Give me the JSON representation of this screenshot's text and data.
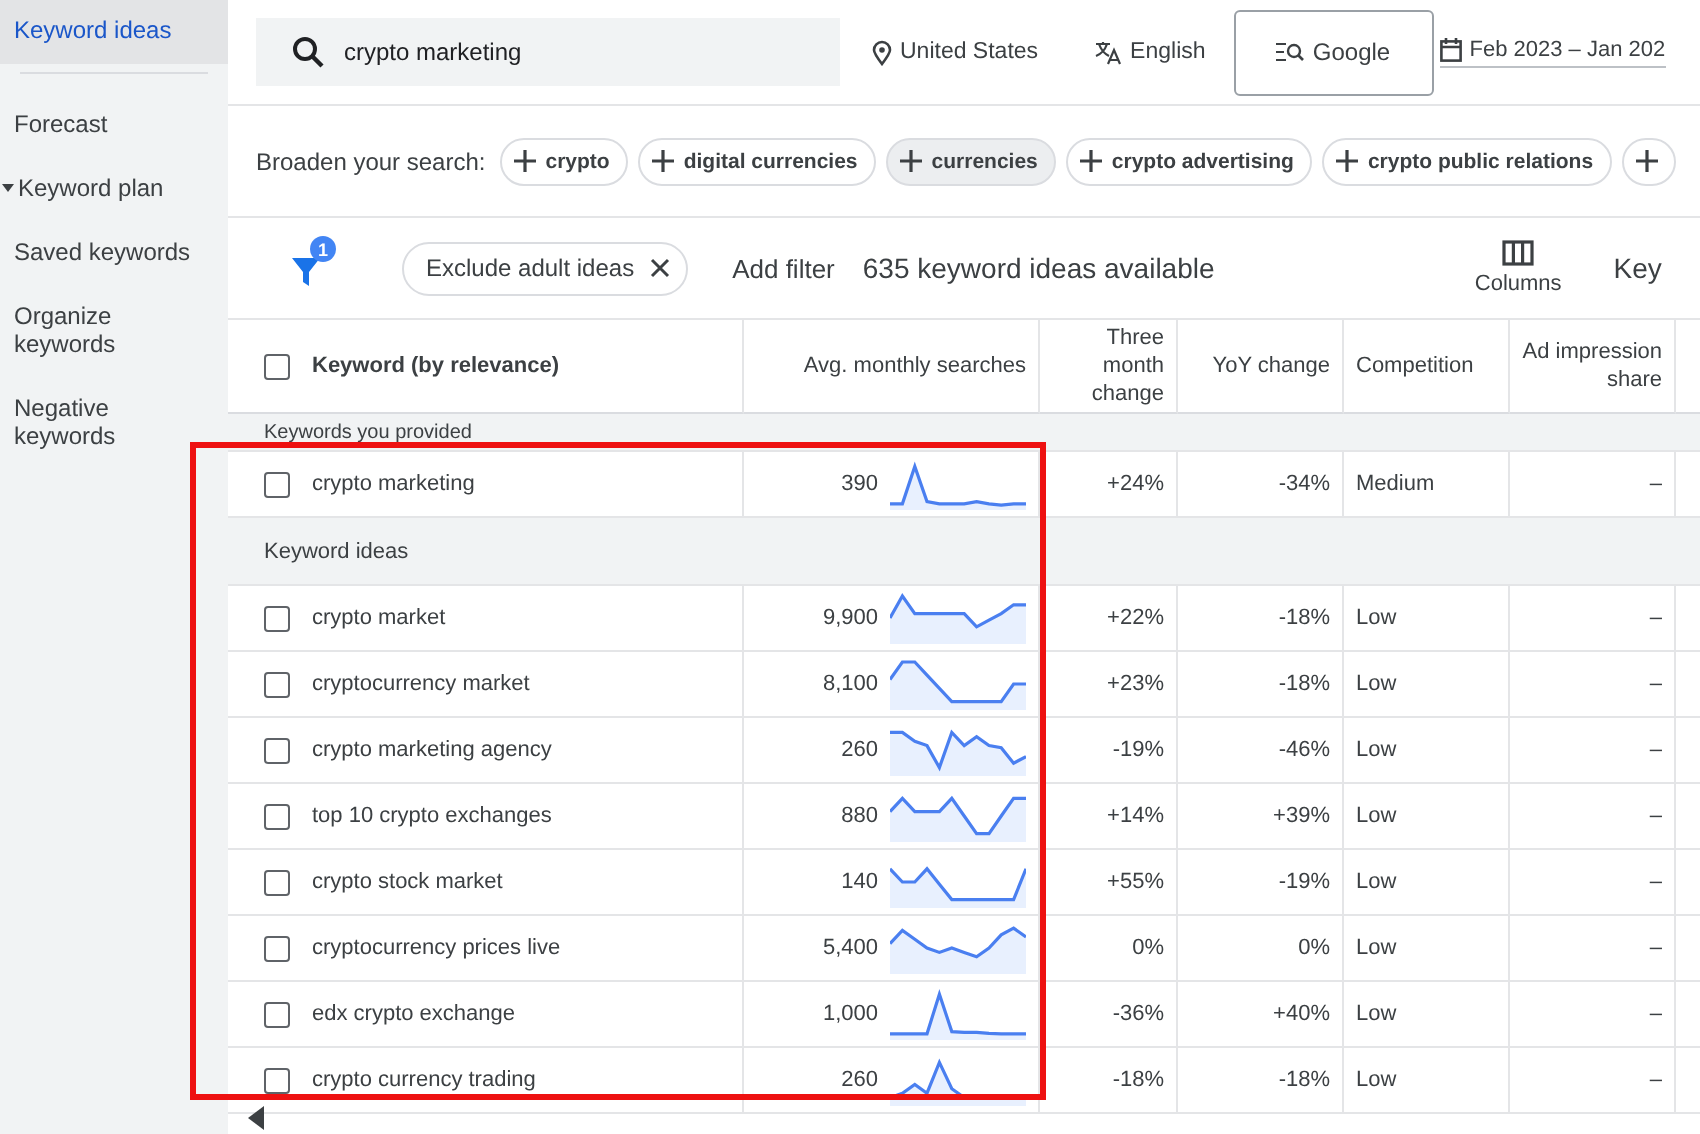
{
  "sidebar": {
    "items": [
      {
        "label": "Keyword ideas",
        "selected": true,
        "kind": "link"
      },
      {
        "label": "Forecast",
        "selected": false,
        "kind": "link"
      },
      {
        "label": "Keyword plan",
        "selected": false,
        "kind": "group"
      },
      {
        "label": "Saved keywords",
        "selected": false,
        "kind": "link"
      },
      {
        "label": "Organize keywords",
        "selected": false,
        "kind": "link"
      },
      {
        "label": "Negative keywords",
        "selected": false,
        "kind": "link"
      }
    ]
  },
  "top_bar": {
    "search": {
      "value": "crypto marketing"
    },
    "location": "United States",
    "language": "English",
    "network": "Google",
    "date_range": "Feb 2023 – Jan 202"
  },
  "broaden": {
    "label": "Broaden your search:",
    "chips": [
      {
        "label": "crypto",
        "selected": false
      },
      {
        "label": "digital currencies",
        "selected": false
      },
      {
        "label": "currencies",
        "selected": true
      },
      {
        "label": "crypto advertising",
        "selected": false
      },
      {
        "label": "crypto public relations",
        "selected": false
      }
    ]
  },
  "filters": {
    "count": "1",
    "chips": [
      "Exclude adult ideas"
    ],
    "add_filter": "Add filter",
    "summary": "635 keyword ideas available",
    "columns_button": "Columns",
    "next_label": "Key"
  },
  "table": {
    "select_all": {
      "checked": false
    },
    "columns": [
      "Keyword (by relevance)",
      "Avg. monthly searches",
      "Three month change",
      "YoY change",
      "Competition",
      "Ad impression share"
    ],
    "sections": [
      {
        "title": "Keywords you provided",
        "rows": [
          {
            "keyword": "crypto marketing",
            "checked": false,
            "searches": "390",
            "three_month": "+24%",
            "yoy": "-34%",
            "competition": "Medium",
            "ad_share": "–"
          }
        ]
      },
      {
        "title": "Keyword ideas",
        "rows": [
          {
            "keyword": "crypto market",
            "checked": false,
            "searches": "9,900",
            "three_month": "+22%",
            "yoy": "-18%",
            "competition": "Low",
            "ad_share": "–"
          },
          {
            "keyword": "cryptocurrency market",
            "checked": false,
            "searches": "8,100",
            "three_month": "+23%",
            "yoy": "-18%",
            "competition": "Low",
            "ad_share": "–"
          },
          {
            "keyword": "crypto marketing agency",
            "checked": false,
            "searches": "260",
            "three_month": "-19%",
            "yoy": "-46%",
            "competition": "Low",
            "ad_share": "–"
          },
          {
            "keyword": "top 10 crypto exchanges",
            "checked": false,
            "searches": "880",
            "three_month": "+14%",
            "yoy": "+39%",
            "competition": "Low",
            "ad_share": "–"
          },
          {
            "keyword": "crypto stock market",
            "checked": false,
            "searches": "140",
            "three_month": "+55%",
            "yoy": "-19%",
            "competition": "Low",
            "ad_share": "–"
          },
          {
            "keyword": "cryptocurrency prices live",
            "checked": false,
            "searches": "5,400",
            "three_month": "0%",
            "yoy": "0%",
            "competition": "Low",
            "ad_share": "–"
          },
          {
            "keyword": "edx crypto exchange",
            "checked": false,
            "searches": "1,000",
            "three_month": "-36%",
            "yoy": "+40%",
            "competition": "Low",
            "ad_share": "–"
          },
          {
            "keyword": "crypto currency trading",
            "checked": false,
            "searches": "260",
            "three_month": "-18%",
            "yoy": "-18%",
            "competition": "Low",
            "ad_share": "–"
          }
        ]
      }
    ]
  }
}
